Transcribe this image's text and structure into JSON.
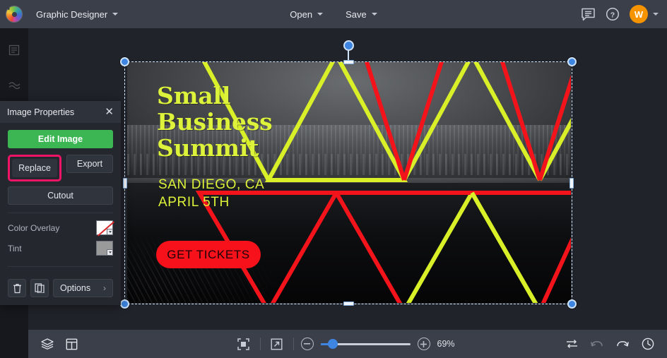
{
  "topbar": {
    "logo_icon": "color-wheel-logo",
    "app_name": "Graphic Designer",
    "menus": [
      {
        "label": "Open",
        "name": "open-menu"
      },
      {
        "label": "Save",
        "name": "save-menu"
      }
    ],
    "comment_icon": "comment-icon",
    "help_icon": "help-circle-icon",
    "avatar_initial": "W",
    "avatar_color": "#f59400"
  },
  "left_rail": {
    "items": [
      {
        "icon": "layout-template-icon"
      },
      {
        "icon": "effects-waves-icon"
      },
      {
        "icon": "chart-columns-icon"
      }
    ]
  },
  "panel": {
    "title": "Image Properties",
    "close_icon": "close-icon",
    "edit_image": "Edit Image",
    "replace": "Replace",
    "export": "Export",
    "cutout": "Cutout",
    "color_overlay_label": "Color Overlay",
    "color_overlay_value": "none",
    "tint_label": "Tint",
    "tint_value": "#9a9a9a",
    "delete_icon": "trash-icon",
    "duplicate_icon": "duplicate-icon",
    "options": "Options",
    "options_chevron": "chevron-right-icon",
    "highlight_color": "#ef1466",
    "edit_button_color": "#3cb553"
  },
  "artboard": {
    "title_line1": "Small",
    "title_line2": "Business",
    "title_line3": "Summit",
    "sub_line1": "SAN DIEGO, CA",
    "sub_line2": "APRIL 5TH",
    "cta": "GET TICKETS",
    "accent_yellow": "#ddf23a",
    "accent_red": "#f6111b",
    "photo_description": "black and white aerial cityscape harbor"
  },
  "bottombar": {
    "layers_icon": "layers-icon",
    "pages_icon": "page-layout-icon",
    "fit_icon": "fit-to-screen-icon",
    "fullscreen_icon": "expand-arrow-icon",
    "zoom_out_icon": "minus-icon",
    "zoom_in_icon": "plus-icon",
    "zoom_value": "69%",
    "zoom_percent": 69,
    "swap_icon": "swap-arrows-icon",
    "undo_icon": "undo-icon",
    "redo_icon": "redo-icon",
    "history_icon": "history-clock-icon"
  }
}
